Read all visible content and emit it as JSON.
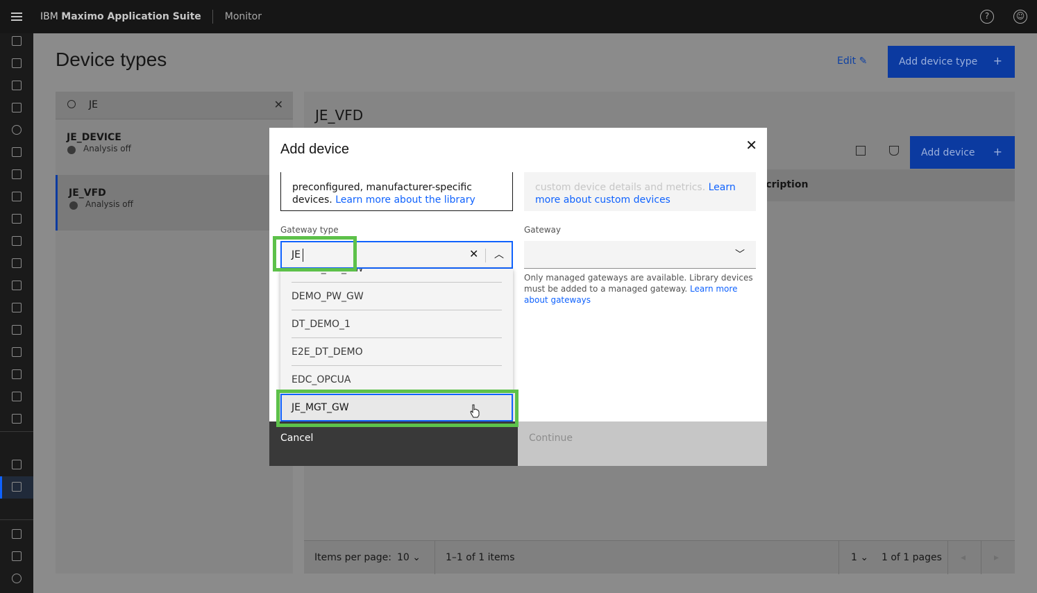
{
  "header": {
    "brand_prefix": "IBM",
    "brand_name": "Maximo Application Suite",
    "product": "Monitor",
    "help_icon": "help-icon",
    "user_icon": "user-icon"
  },
  "page": {
    "title": "Device types",
    "edit_label": "Edit",
    "add_type_label": "Add device type"
  },
  "left_panel": {
    "search_value": "JE",
    "items": [
      {
        "name": "JE_DEVICE",
        "status": "Analysis off"
      },
      {
        "name": "JE_VFD",
        "status": "Analysis off"
      }
    ]
  },
  "right_panel": {
    "title": "JE_VFD",
    "add_device_label": "Add device",
    "column_header": "scription"
  },
  "pager": {
    "items_per_page_label": "Items per page:",
    "items_per_page": "10",
    "range": "1–1 of 1 items",
    "page": "1",
    "pages": "1 of 1 pages"
  },
  "modal": {
    "title": "Add device",
    "library_tile": {
      "text": "preconfigured, manufacturer-specific devices.",
      "link": "Learn more about the library"
    },
    "custom_tile": {
      "text": "custom device details and metrics.",
      "link_1": "Learn",
      "link_2": "more about custom devices"
    },
    "gateway_type": {
      "label": "Gateway type",
      "value": "JE",
      "options": [
        "DEMO_PRI_GW",
        "DEMO_PW_GW",
        "DT_DEMO_1",
        "E2E_DT_DEMO",
        "EDC_OPCUA",
        "JE_MGT_GW"
      ]
    },
    "gateway": {
      "label": "Gateway",
      "value": "",
      "helper": "Only managed gateways are available. Library devices must be added to a managed gateway.",
      "helper_link_1": "Learn more about",
      "helper_link_2": "gateways"
    },
    "cancel_label": "Cancel",
    "continue_label": "Continue"
  },
  "colors": {
    "accent": "#0f62fe",
    "highlight": "#5dc14a",
    "header_bg": "#161616"
  }
}
